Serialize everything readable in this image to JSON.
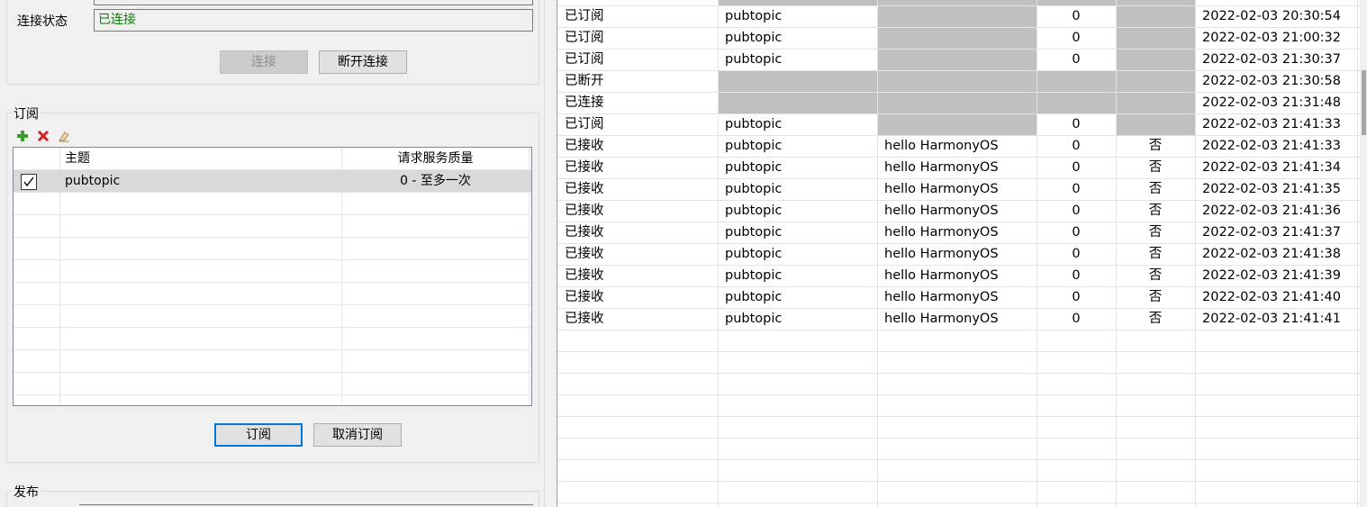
{
  "connection": {
    "status_label": "连接状态",
    "status_value": "已连接",
    "status_color": "#008000",
    "connect_label": "连接",
    "disconnect_label": "断开连接"
  },
  "subscribe": {
    "group_title": "订阅",
    "toolbar": [
      "add-icon",
      "delete-icon",
      "eraser-icon"
    ],
    "columns": [
      "主题",
      "请求服务质量"
    ],
    "rows": [
      {
        "checked": true,
        "topic": "pubtopic",
        "qos": "0 - 至多一次"
      }
    ],
    "subscribe_label": "订阅",
    "unsubscribe_label": "取消订阅"
  },
  "publish": {
    "group_title": "发布"
  },
  "history": {
    "rows": [
      {
        "event": "已订阅",
        "topic": "pubtopic",
        "message": "",
        "qos": "0",
        "retained": "",
        "time": "2022-02-03 20:30:54"
      },
      {
        "event": "已订阅",
        "topic": "pubtopic",
        "message": "",
        "qos": "0",
        "retained": "",
        "time": "2022-02-03 21:00:32"
      },
      {
        "event": "已订阅",
        "topic": "pubtopic",
        "message": "",
        "qos": "0",
        "retained": "",
        "time": "2022-02-03 21:30:37"
      },
      {
        "event": "已断开",
        "topic": "",
        "message": "",
        "qos": "",
        "retained": "",
        "time": "2022-02-03 21:30:58"
      },
      {
        "event": "已连接",
        "topic": "",
        "message": "",
        "qos": "",
        "retained": "",
        "time": "2022-02-03 21:31:48"
      },
      {
        "event": "已订阅",
        "topic": "pubtopic",
        "message": "",
        "qos": "0",
        "retained": "",
        "time": "2022-02-03 21:41:33"
      },
      {
        "event": "已接收",
        "topic": "pubtopic",
        "message": "hello HarmonyOS",
        "qos": "0",
        "retained": "否",
        "time": "2022-02-03 21:41:33"
      },
      {
        "event": "已接收",
        "topic": "pubtopic",
        "message": "hello HarmonyOS",
        "qos": "0",
        "retained": "否",
        "time": "2022-02-03 21:41:34"
      },
      {
        "event": "已接收",
        "topic": "pubtopic",
        "message": "hello HarmonyOS",
        "qos": "0",
        "retained": "否",
        "time": "2022-02-03 21:41:35"
      },
      {
        "event": "已接收",
        "topic": "pubtopic",
        "message": "hello HarmonyOS",
        "qos": "0",
        "retained": "否",
        "time": "2022-02-03 21:41:36"
      },
      {
        "event": "已接收",
        "topic": "pubtopic",
        "message": "hello HarmonyOS",
        "qos": "0",
        "retained": "否",
        "time": "2022-02-03 21:41:37"
      },
      {
        "event": "已接收",
        "topic": "pubtopic",
        "message": "hello HarmonyOS",
        "qos": "0",
        "retained": "否",
        "time": "2022-02-03 21:41:38"
      },
      {
        "event": "已接收",
        "topic": "pubtopic",
        "message": "hello HarmonyOS",
        "qos": "0",
        "retained": "否",
        "time": "2022-02-03 21:41:39"
      },
      {
        "event": "已接收",
        "topic": "pubtopic",
        "message": "hello HarmonyOS",
        "qos": "0",
        "retained": "否",
        "time": "2022-02-03 21:41:40"
      },
      {
        "event": "已接收",
        "topic": "pubtopic",
        "message": "hello HarmonyOS",
        "qos": "0",
        "retained": "否",
        "time": "2022-02-03 21:41:41"
      }
    ]
  },
  "colors": {
    "blank_cell": "#c0c0c0",
    "selected_row": "#d9d9d9",
    "add_icon": "#3c9a2e",
    "delete_icon": "#d42020"
  }
}
